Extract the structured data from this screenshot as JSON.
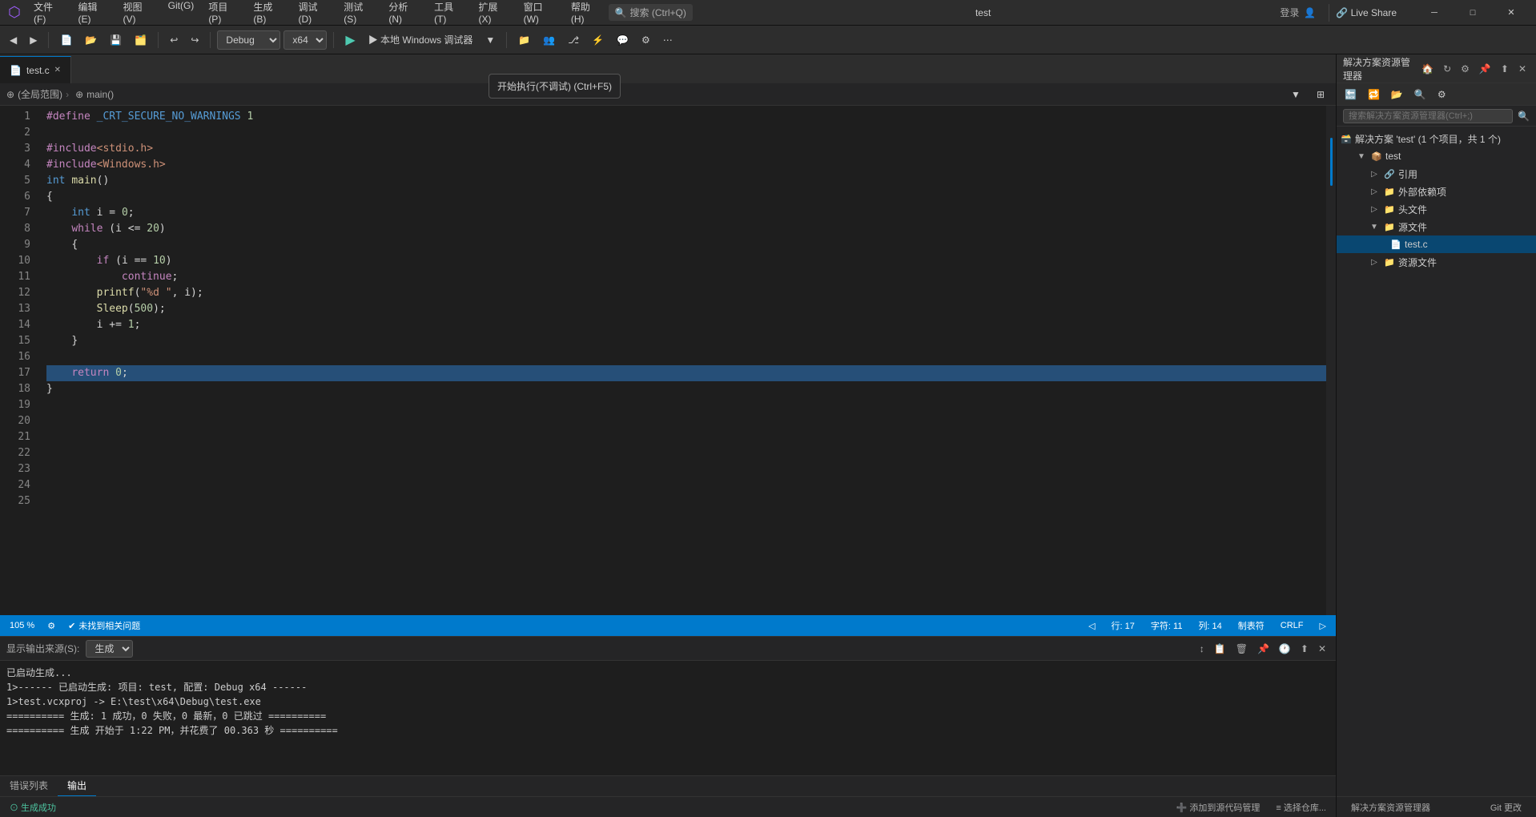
{
  "titlebar": {
    "logo": "⬡",
    "menus": [
      "文件(F)",
      "编辑(E)",
      "视图(V)",
      "Git(G)",
      "项目(P)",
      "生成(B)",
      "调试(D)",
      "测试(S)",
      "分析(N)",
      "工具(T)",
      "扩展(X)",
      "窗口(W)",
      "帮助(H)"
    ],
    "search_label": "搜索 (Ctrl+Q)",
    "title": "test",
    "login": "登录",
    "live_share": "🔗 Live Share",
    "minimize": "─",
    "maximize": "□",
    "close": "✕"
  },
  "toolbar": {
    "config": "Debug",
    "platform": "x64",
    "run_label": "▶ 本地 Windows 调试器",
    "tooltip": "开始执行(不调试) (Ctrl+F5)"
  },
  "editor": {
    "tab_name": "test.c",
    "breadcrumb_scope": "(全局范围)",
    "breadcrumb_function": "main()",
    "lines": [
      {
        "n": 1,
        "code": "#define _CRT_SECURE_NO_WARNINGS 1"
      },
      {
        "n": 2,
        "code": ""
      },
      {
        "n": 3,
        "code": "#include<stdio.h>"
      },
      {
        "n": 4,
        "code": "#include<Windows.h>"
      },
      {
        "n": 5,
        "code": "int main()"
      },
      {
        "n": 6,
        "code": "{"
      },
      {
        "n": 7,
        "code": "    int i = 0;"
      },
      {
        "n": 8,
        "code": "    while (i <= 20)"
      },
      {
        "n": 9,
        "code": "    {"
      },
      {
        "n": 10,
        "code": "        if (i == 10)"
      },
      {
        "n": 11,
        "code": "            continue;"
      },
      {
        "n": 12,
        "code": "        printf(\"%d \", i);"
      },
      {
        "n": 13,
        "code": "        Sleep(500);"
      },
      {
        "n": 14,
        "code": "        i += 1;"
      },
      {
        "n": 15,
        "code": "    }"
      },
      {
        "n": 16,
        "code": ""
      },
      {
        "n": 17,
        "code": "    return 0;"
      },
      {
        "n": 18,
        "code": "}"
      },
      {
        "n": 19,
        "code": ""
      },
      {
        "n": 20,
        "code": ""
      },
      {
        "n": 21,
        "code": ""
      },
      {
        "n": 22,
        "code": ""
      },
      {
        "n": 23,
        "code": ""
      },
      {
        "n": 24,
        "code": ""
      },
      {
        "n": 25,
        "code": ""
      }
    ]
  },
  "status_bar": {
    "zoom": "105 %",
    "error_label": "⚙",
    "no_problems": "未找到相关问题",
    "row": "行: 17",
    "char": "字符: 11",
    "col": "列: 14",
    "tab": "制表符",
    "encoding": "CRLF"
  },
  "output_panel": {
    "title": "输出",
    "source_label": "显示输出来源(S):",
    "source_value": "生成",
    "lines": [
      "已启动生成...",
      "1>------ 已启动生成: 项目: test, 配置: Debug x64 ------",
      "1>test.vcxproj -> E:\\test\\x64\\Debug\\test.exe",
      "========== 生成: 1 成功，0 失败，0 最新，0 已跳过 ==========",
      "========== 生成 开始于 1:22 PM，并花费了 00.363 秒 =========="
    ]
  },
  "bottom_tabs": [
    {
      "label": "错误列表",
      "active": false
    },
    {
      "label": "输出",
      "active": true
    }
  ],
  "bottom_status": {
    "left": "⊙ 生成成功",
    "add_repo": "➕ 添加到源代码管理",
    "select_repo": "≡ 选择仓库..."
  },
  "solution_explorer": {
    "title": "解决方案资源管理器",
    "search_placeholder": "搜索解决方案资源管理器(Ctrl+;)",
    "tree": {
      "solution": "解决方案 'test' (1 个项目，共 1 个)",
      "project": "test",
      "nodes": [
        {
          "label": "引用",
          "indent": 2,
          "type": "folder",
          "icon": "ref"
        },
        {
          "label": "外部依赖项",
          "indent": 2,
          "type": "folder",
          "icon": "folder"
        },
        {
          "label": "头文件",
          "indent": 2,
          "type": "folder",
          "icon": "folder"
        },
        {
          "label": "源文件",
          "indent": 2,
          "type": "folder",
          "icon": "folder",
          "expanded": true
        },
        {
          "label": "test.c",
          "indent": 3,
          "type": "file",
          "icon": "c-file"
        },
        {
          "label": "资源文件",
          "indent": 2,
          "type": "folder",
          "icon": "folder"
        }
      ]
    },
    "footer_left": "解决方案资源管理器",
    "footer_right": "Git 更改"
  }
}
